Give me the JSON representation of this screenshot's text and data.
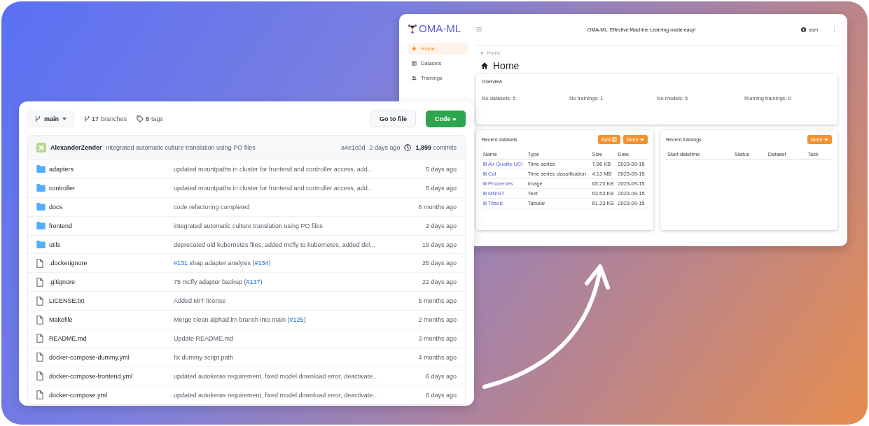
{
  "oma": {
    "logo": "OMA-ML",
    "title": "OMA-ML: Effective Machine Learning made easy!",
    "user": "user",
    "more_glyph": "⋮",
    "nav": [
      {
        "label": "Home",
        "selected": true
      },
      {
        "label": "Datasets",
        "selected": false
      },
      {
        "label": "Trainings",
        "selected": false
      }
    ],
    "breadcrumb": "Home",
    "heading": "Home",
    "overview": {
      "title": "Overview",
      "stats": [
        "No datasets: 5",
        "No trainings: 1",
        "No models: 5",
        "Running trainings: 0"
      ]
    },
    "datasets": {
      "title": "Recent datasets",
      "buttons": [
        "Add",
        "More"
      ],
      "columns": [
        "Name",
        "Type",
        "Size",
        "Date"
      ],
      "rows": [
        [
          "Air Quality UCI",
          "Time series",
          "7.86 KB",
          "2023-09-15"
        ],
        [
          "Cat",
          "Time series classification",
          "4.13 MB",
          "2023-09-15"
        ],
        [
          "Phonemes",
          "Image",
          "65.23 KB",
          "2023-09-15"
        ],
        [
          "MNIST",
          "Text",
          "63.53 KB",
          "2023-09-15"
        ],
        [
          "Titanic",
          "Tabular",
          "61.23 KB",
          "2023-09-15"
        ]
      ]
    },
    "trainings": {
      "title": "Recent trainings",
      "buttons": [
        "More"
      ],
      "columns": [
        "Start datetime",
        "Status",
        "Dataset",
        "Task"
      ]
    }
  },
  "repo": {
    "branch": "main",
    "branches": "**17** branches",
    "tags": "**8** tags",
    "go_to_file": "Go to file",
    "code": "Code",
    "commit": {
      "author": "AlexanderZender",
      "message": "integrated automatic culture translation using PO files",
      "hash": "a4e1c0d",
      "time": "2 days ago",
      "commits": "**1,899** commits"
    },
    "files": [
      {
        "kind": "folder",
        "name": "adapters",
        "message": [
          {
            "text": "updated mountpaths in cluster for frontend and controller access, add...",
            "link": false
          }
        ],
        "time": "5 days ago"
      },
      {
        "kind": "folder",
        "name": "controller",
        "message": [
          {
            "text": "updated mountpaths in cluster for frontend and controller access, add...",
            "link": false
          }
        ],
        "time": "5 days ago"
      },
      {
        "kind": "folder",
        "name": "docs",
        "message": [
          {
            "text": "code refactoring completed",
            "link": false
          }
        ],
        "time": "6 months ago"
      },
      {
        "kind": "folder",
        "name": "frontend",
        "message": [
          {
            "text": "integrated automatic culture translation using PO files",
            "link": false
          }
        ],
        "time": "2 days ago"
      },
      {
        "kind": "folder",
        "name": "utils",
        "message": [
          {
            "text": "deprecated old kubernetes files, added mcfly to kubernetes, added del...",
            "link": false
          }
        ],
        "time": "19 days ago"
      },
      {
        "kind": "file",
        "name": ".dockerignore",
        "message": [
          {
            "text": "#131",
            "link": true
          },
          {
            "text": " shap adapter analysis (",
            "link": false
          },
          {
            "text": "#134",
            "link": true
          },
          {
            "text": ")",
            "link": false
          }
        ],
        "time": "25 days ago"
      },
      {
        "kind": "file",
        "name": ".gitignore",
        "message": [
          {
            "text": "75 mcfly adapter backup (",
            "link": false
          },
          {
            "text": "#137",
            "link": true
          },
          {
            "text": ")",
            "link": false
          }
        ],
        "time": "22 days ago"
      },
      {
        "kind": "file",
        "name": "LICENSE.txt",
        "message": [
          {
            "text": "Added MIT license",
            "link": false
          }
        ],
        "time": "5 months ago"
      },
      {
        "kind": "file",
        "name": "Makefile",
        "message": [
          {
            "text": "Merge clean alphad.lm branch into main (",
            "link": false
          },
          {
            "text": "#125",
            "link": true
          },
          {
            "text": ")",
            "link": false
          }
        ],
        "time": "2 months ago"
      },
      {
        "kind": "file",
        "name": "README.md",
        "message": [
          {
            "text": "Update README.md",
            "link": false
          }
        ],
        "time": "3 months ago"
      },
      {
        "kind": "file",
        "name": "docker-compose-dummy.yml",
        "message": [
          {
            "text": "fix dummy script path",
            "link": false
          }
        ],
        "time": "4 months ago"
      },
      {
        "kind": "file",
        "name": "docker-compose-frontend.yml",
        "message": [
          {
            "text": "updated autokeras requirement, fixed model download error, deactivate...",
            "link": false
          }
        ],
        "time": "6 days ago"
      },
      {
        "kind": "file",
        "name": "docker-compose.yml",
        "message": [
          {
            "text": "updated autokeras requirement, fixed model download error, deactivate...",
            "link": false
          }
        ],
        "time": "6 days ago"
      }
    ]
  }
}
